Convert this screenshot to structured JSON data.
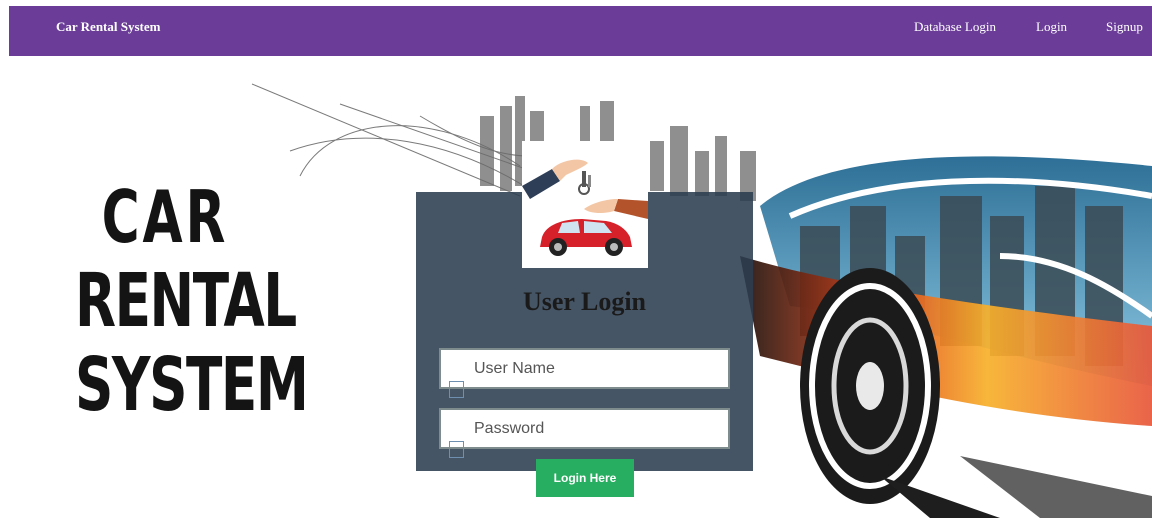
{
  "navbar": {
    "brand": "Car Rental System",
    "links": [
      "Database Login",
      "Login",
      "Signup"
    ],
    "background": "#6b3d99"
  },
  "hero": {
    "title_lines": [
      "CAR",
      "RENTAL",
      "SYSTEM"
    ]
  },
  "login": {
    "title": "User Login",
    "username_placeholder": "User Name",
    "password_placeholder": "Password",
    "submit_label": "Login Here",
    "panel_color": "#2c3e50",
    "button_color": "#27ae60",
    "username_icon": "user-icon",
    "password_icon": "lock-icon"
  }
}
